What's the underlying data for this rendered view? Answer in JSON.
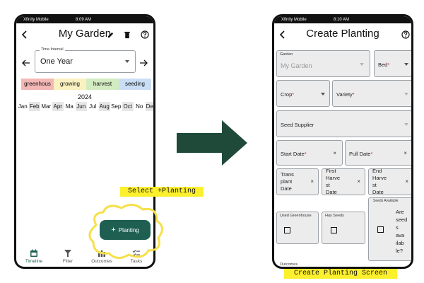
{
  "left_screen": {
    "carrier": "Xfinity Mobile",
    "time": "8:09 AM",
    "title": "My Garden",
    "time_interval": {
      "label": "Time Interval",
      "value": "One Year"
    },
    "stages": [
      "greenhous",
      "growing",
      "harvest",
      "seeding"
    ],
    "year": "2024",
    "months": [
      "Jan",
      "Feb",
      "Mar",
      "Apr",
      "Ma",
      "Jun",
      "Jul",
      "Aug",
      "Sep",
      "Oct",
      "No",
      "Dec"
    ],
    "fab_label": "Planting",
    "nav": [
      "Timeline",
      "Filter",
      "Outcomes",
      "Tasks"
    ]
  },
  "right_screen": {
    "carrier": "Xfinity Mobile",
    "time": "8:10 AM",
    "title": "Create Planting",
    "garden": {
      "label": "Garden",
      "value": "My Garden"
    },
    "bed": "Bed",
    "crop": "Crop",
    "variety": "Variety",
    "seed_supplier": "Seed Supplier",
    "start_date": "Start Date",
    "pull_date": "Pull Date",
    "transplant_date": [
      "Trans",
      "plant",
      "Date"
    ],
    "first_harvest_date": [
      "First",
      "Harve",
      "st",
      "Date"
    ],
    "end_harvest_date": [
      "End",
      "Harve",
      "st",
      "Date"
    ],
    "used_greenhouse": "Used Greenhouse",
    "has_seeds": "Has Seeds",
    "seeds_available": {
      "label": "Seeds Available",
      "text": [
        "Are",
        "seed",
        "s",
        "ava",
        "ilab",
        "le?"
      ]
    },
    "outcomes": "Outcomes"
  },
  "annotations": {
    "select_planting": "Select +Planting",
    "create_planting_screen": "Create Planting Screen"
  },
  "colors": {
    "primary": "#1e5f52",
    "highlight": "#fcef2c",
    "greenhouse": "#f3b8b5",
    "growing": "#fbf1c0",
    "harvest": "#d3ebc0",
    "seeding": "#c9def5"
  }
}
